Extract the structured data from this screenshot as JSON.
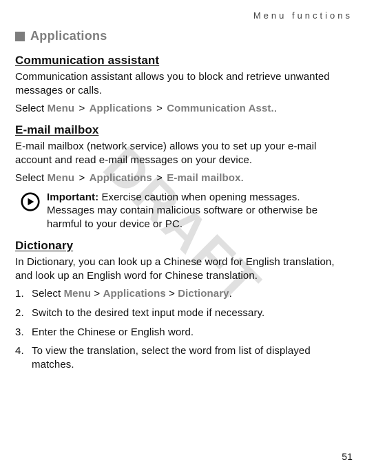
{
  "header": {
    "running": "Menu functions"
  },
  "section": {
    "title": "Applications"
  },
  "ca": {
    "heading": "Communication assistant",
    "body": "Communication assistant allows you to block and retrieve unwanted messages or calls.",
    "nav": {
      "label": "Select",
      "items": [
        "Menu",
        "Applications",
        "Communication Asst."
      ],
      "suffix": "."
    }
  },
  "em": {
    "heading": "E-mail mailbox",
    "body": "E-mail mailbox (network service) allows you to set up your e-mail account and read e-mail messages on your device.",
    "nav": {
      "label": "Select",
      "items": [
        "Menu",
        "Applications",
        "E-mail mailbox"
      ],
      "suffix": "."
    },
    "callout": {
      "lead": "Important:",
      "text": " Exercise caution when opening messages. Messages may contain malicious software or otherwise be harmful to your device or PC."
    }
  },
  "dict": {
    "heading": "Dictionary",
    "body": "In Dictionary, you can look up a Chinese word for English translation, and look up an English word for Chinese translation.",
    "steps": [
      {
        "prefix": "Select ",
        "nav": {
          "items": [
            "Menu",
            "Applications",
            "Dictionary"
          ],
          "suffix": "."
        }
      },
      {
        "text": "Switch to the desired text input mode if necessary."
      },
      {
        "text": "Enter the Chinese or English word."
      },
      {
        "text": "To view the translation, select the word from list of displayed matches."
      }
    ]
  },
  "watermark": "DRAFT",
  "page_number": "51"
}
